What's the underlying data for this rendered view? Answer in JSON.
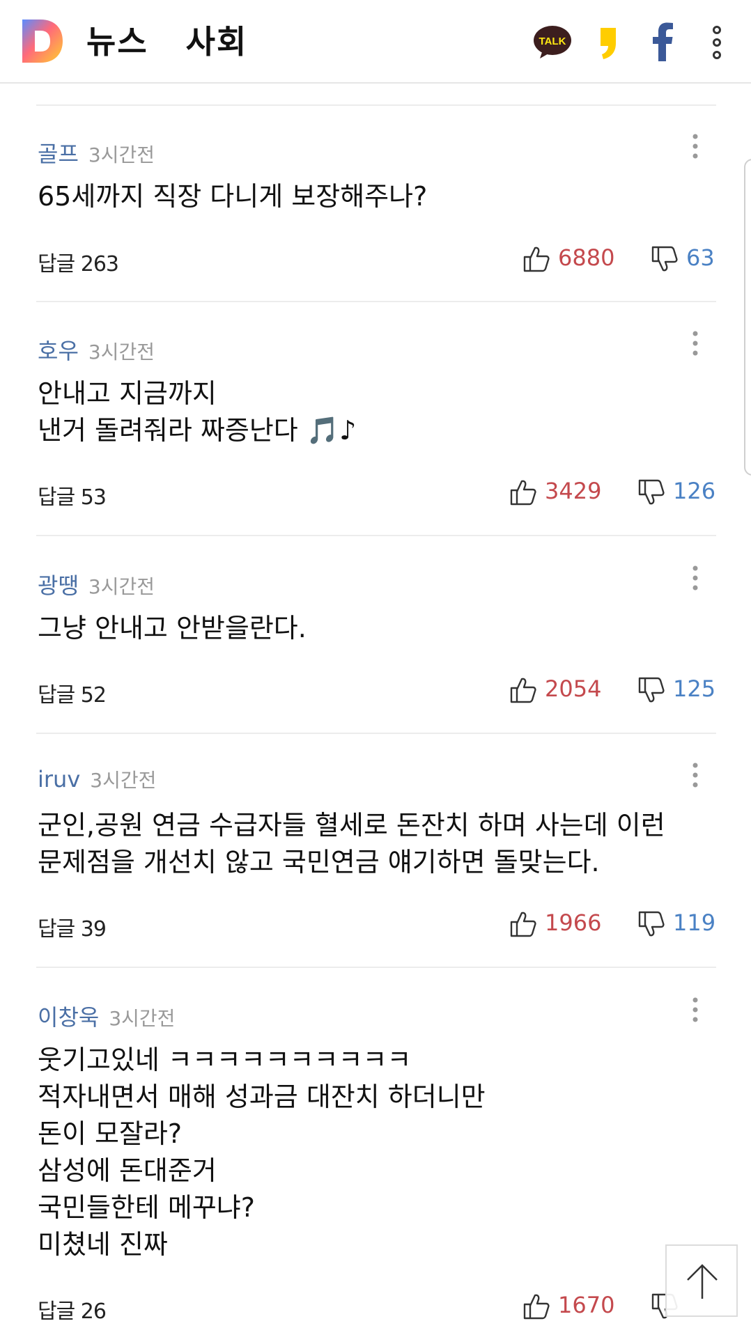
{
  "header": {
    "title": "뉴스   사회",
    "share_icons": [
      "kakaotalk-icon",
      "kakaostory-icon",
      "facebook-icon",
      "more-icon"
    ],
    "talk_label": "TALK",
    "brand_colors": {
      "logo_gradient": [
        "#ff6a3d",
        "#ffcf2e",
        "#5a8cff"
      ],
      "talk_bg": "#3c1e1e",
      "story_yellow": "#ffcd00",
      "facebook_blue": "#3b5998"
    }
  },
  "comments": [
    {
      "author": "골프",
      "time": "3시간전",
      "body": "65세까지 직장 다니게 보장해주나?",
      "replies": "답글 263",
      "likes": "6880",
      "dislikes": "63"
    },
    {
      "author": "호우",
      "time": "3시간전",
      "body": "안내고 지금까지\n낸거 돌려줘라 짜증난다 🎵♪",
      "replies": "답글 53",
      "likes": "3429",
      "dislikes": "126"
    },
    {
      "author": "광땡",
      "time": "3시간전",
      "body": "그냥 안내고 안받을란다.",
      "replies": "답글 52",
      "likes": "2054",
      "dislikes": "125"
    },
    {
      "author": "iruv",
      "time": "3시간전",
      "body": "군인,공원 연금 수급자들  혈세로  돈잔치 하며 사는데 이런\n문제점을 개선치 않고 국민연금 얘기하면  돌맞는다.",
      "replies": "답글 39",
      "likes": "1966",
      "dislikes": "119"
    },
    {
      "author": "이창욱",
      "time": "3시간전",
      "body": "웃기고있네  ㅋㅋㅋㅋㅋㅋㅋㅋㅋㅋ\n적자내면서   매해  성과금  대잔치  하더니만\n돈이  모잘라?\n삼성에  돈대준거\n국민들한테  메꾸냐?\n미쳤네  진짜",
      "replies": "답글 26",
      "likes": "1670",
      "dislikes": ""
    }
  ],
  "colors": {
    "author": "#4a6fa5",
    "like": "#c4494d",
    "dislike": "#4a81c4"
  }
}
